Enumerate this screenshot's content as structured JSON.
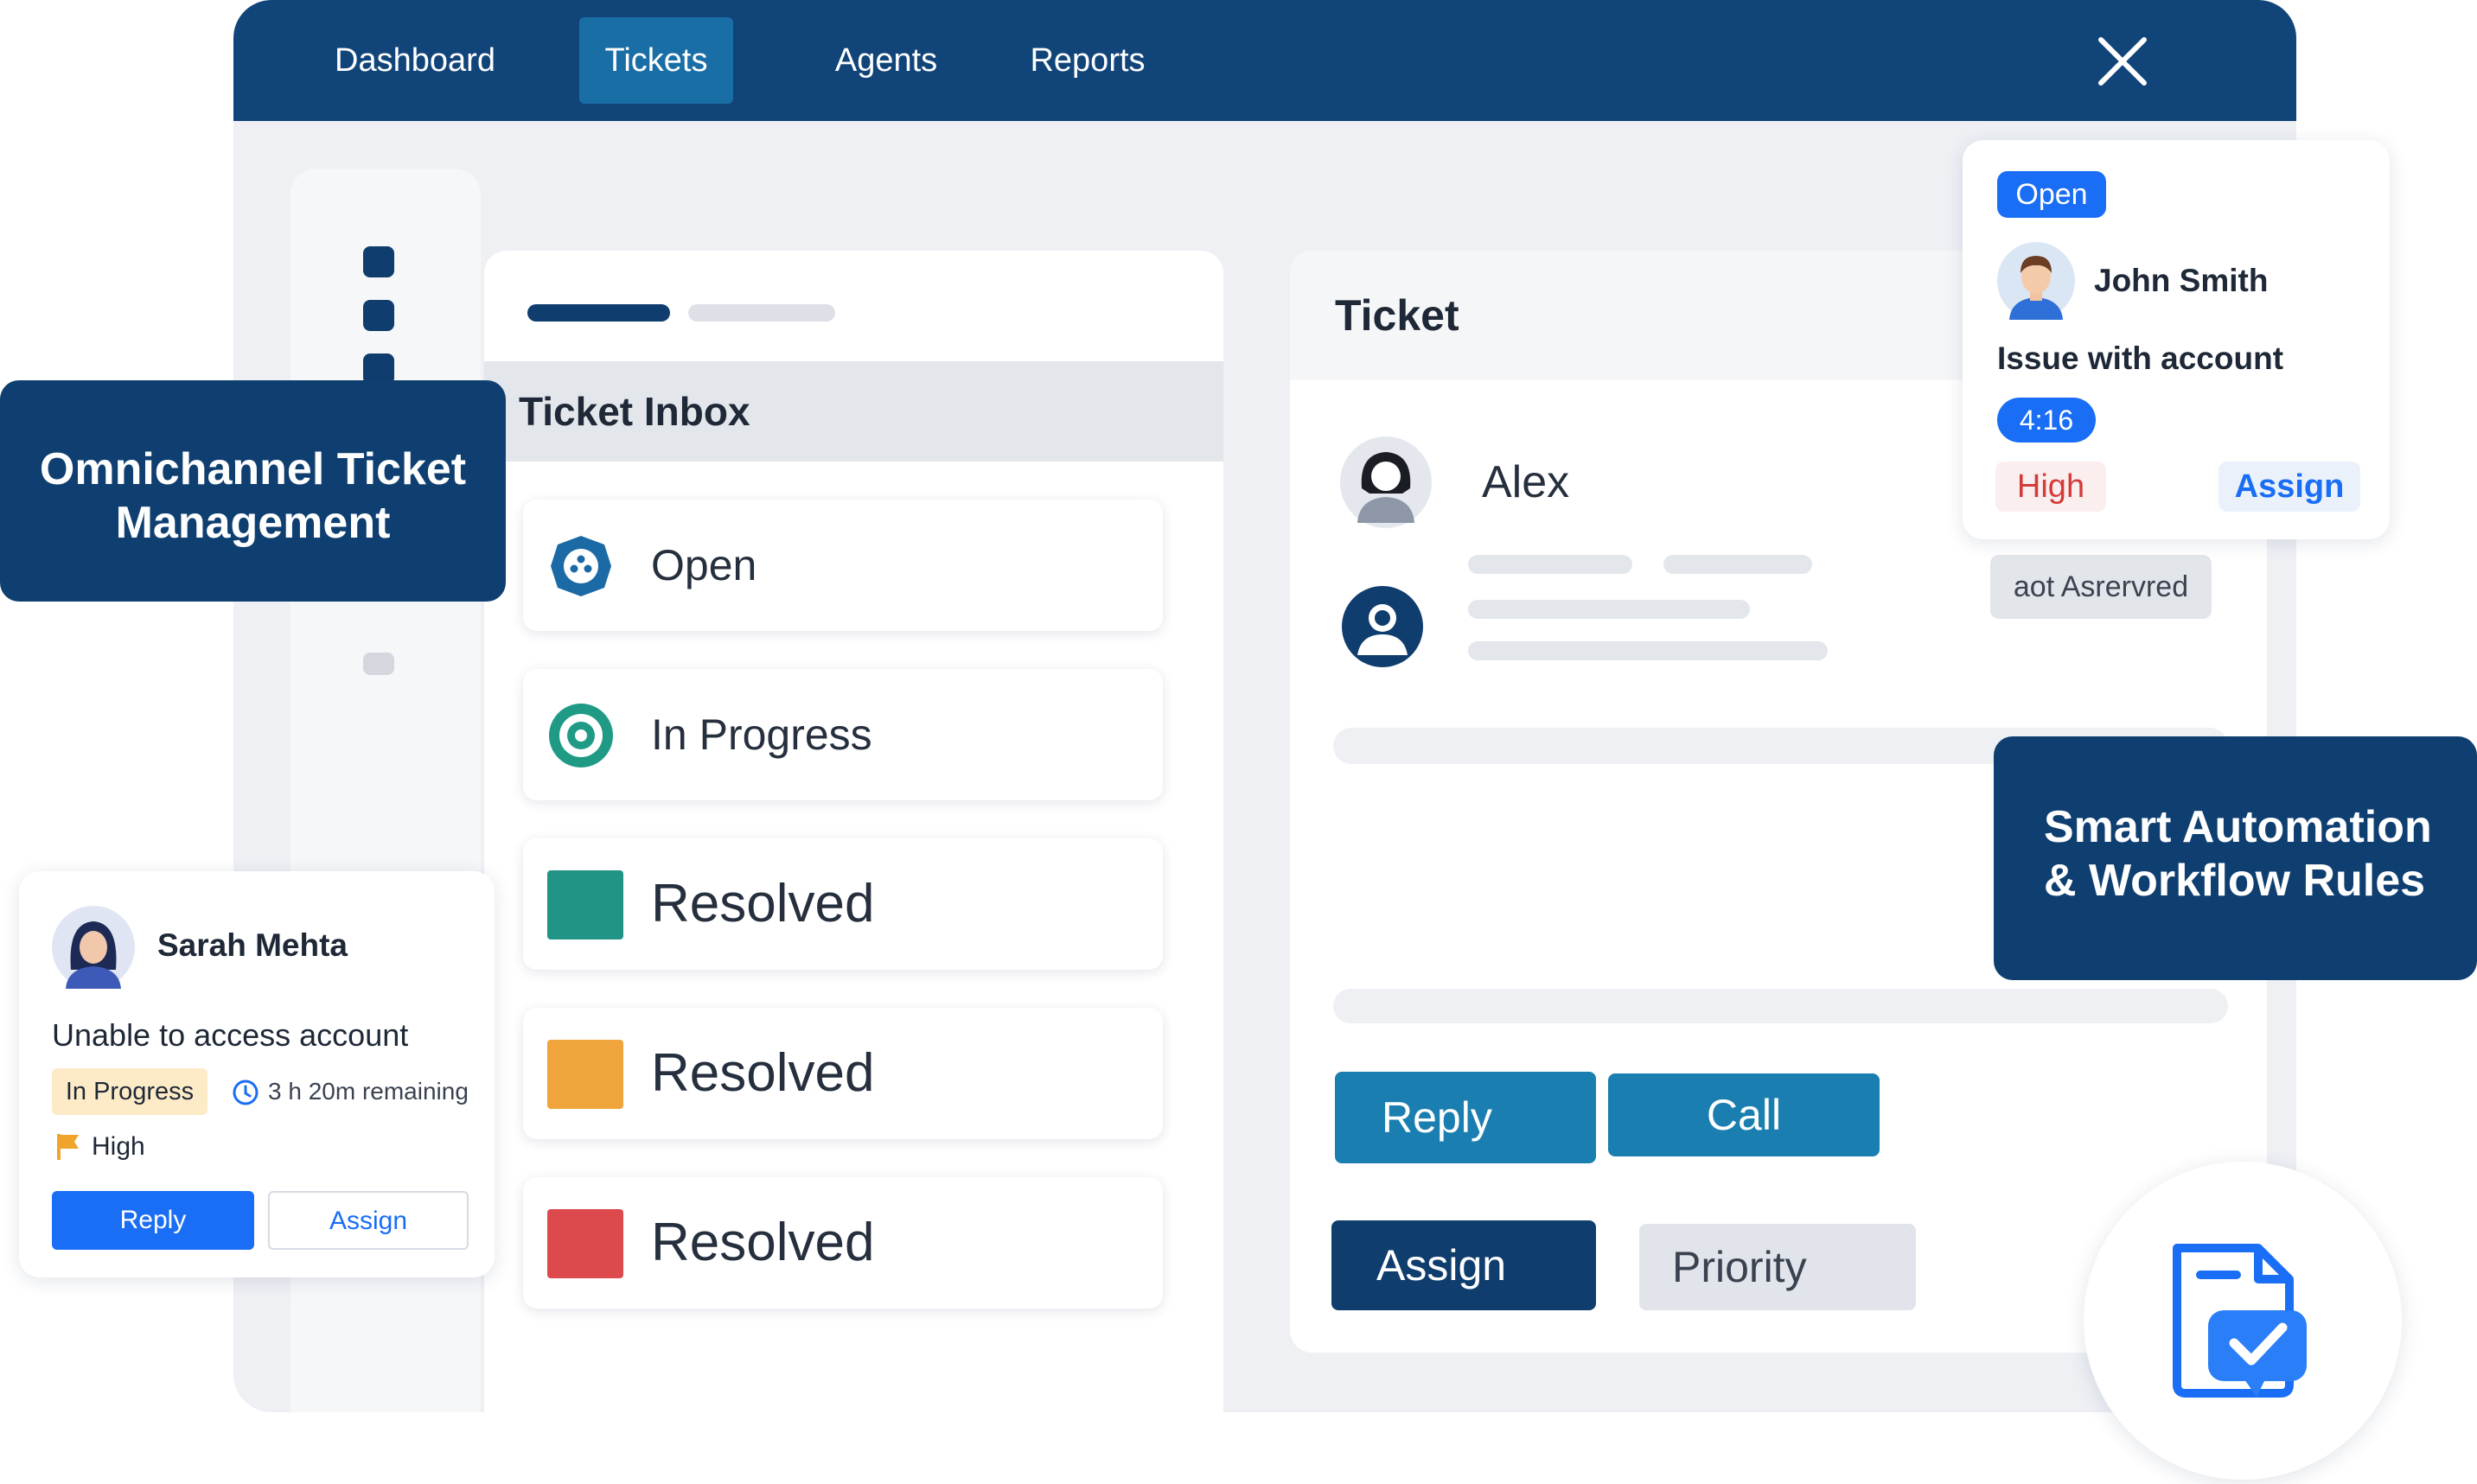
{
  "nav": {
    "items": [
      "Dashboard",
      "Tickets",
      "Agents",
      "Reports"
    ],
    "active": "Tickets"
  },
  "inbox": {
    "title": "Ticket Inbox",
    "items": [
      {
        "label": "Open",
        "icon": "info-circle-icon",
        "color": "#1b6aa5"
      },
      {
        "label": "In Progress",
        "icon": "target-circle-icon",
        "color": "#1f9b85"
      },
      {
        "label": "Resolved",
        "icon": "square-icon",
        "color": "#229486"
      },
      {
        "label": "Resolved",
        "icon": "square-icon",
        "color": "#f0a43c"
      },
      {
        "label": "Resolved",
        "icon": "square-icon",
        "color": "#dd4a4e"
      }
    ]
  },
  "ticket": {
    "title": "Ticket",
    "contact_name": "Alex",
    "tag": "aot Asrervred",
    "buttons": {
      "reply": "Reply",
      "call": "Call",
      "assign": "Assign",
      "priority": "Priority"
    }
  },
  "callouts": {
    "left_line1": "Omnichannel Ticket",
    "left_line2": "Management",
    "right_line1": "Smart Automation",
    "right_line2": "& Workflow Rules"
  },
  "card_john": {
    "status": "Open",
    "name": "John Smith",
    "issue": "Issue with account",
    "timer": "4:16",
    "priority": "High",
    "assign": "Assign"
  },
  "card_sarah": {
    "name": "Sarah Mehta",
    "issue": "Unable to access account",
    "status": "In Progress",
    "sla": "3 h 20m remaining",
    "priority": "High",
    "reply": "Reply",
    "assign": "Assign"
  },
  "colors": {
    "navy": "#11457a",
    "accent_blue": "#1a6ea6",
    "reply_blue": "#1a7fb0",
    "primary_blue": "#1a6ef5",
    "high_red": "#d53a3a",
    "in_progress_bg": "#fdebc8"
  }
}
